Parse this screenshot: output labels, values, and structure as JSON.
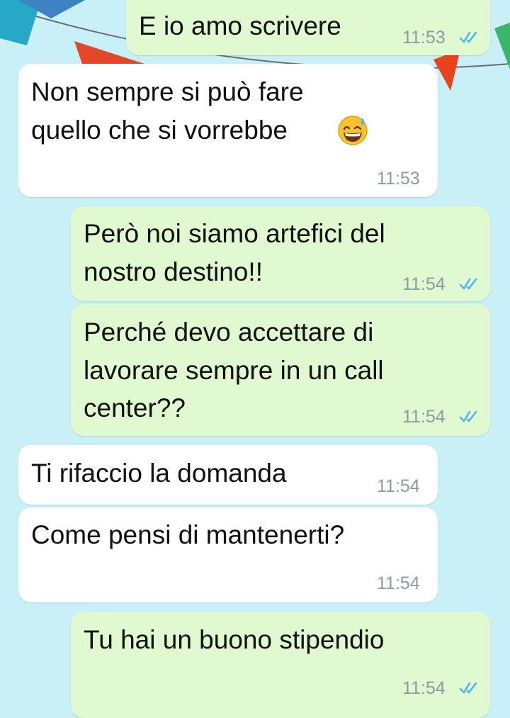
{
  "messages": [
    {
      "id": "m1",
      "direction": "outgoing",
      "lines": [
        "E io amo scrivere"
      ],
      "time": "11:53",
      "status": "read-double-check-icon"
    },
    {
      "id": "m2",
      "direction": "incoming",
      "lines": [
        "Non sempre si può fare",
        "quello che si vorrebbe"
      ],
      "emoji": "grinning-sweat-emoji",
      "time": "11:53"
    },
    {
      "id": "m3",
      "direction": "outgoing",
      "lines": [
        "Però noi siamo artefici del",
        "nostro destino!!"
      ],
      "time": "11:54",
      "status": "read-double-check-icon"
    },
    {
      "id": "m4",
      "direction": "outgoing",
      "lines": [
        "Perché devo accettare di",
        "lavorare sempre in un call",
        "center??"
      ],
      "time": "11:54",
      "status": "read-double-check-icon"
    },
    {
      "id": "m5",
      "direction": "incoming",
      "lines": [
        "Ti rifaccio la domanda"
      ],
      "time": "11:54"
    },
    {
      "id": "m6",
      "direction": "incoming",
      "lines": [
        "Come pensi di mantenerti?"
      ],
      "time": "11:54"
    },
    {
      "id": "m7",
      "direction": "outgoing",
      "lines": [
        "Tu hai un buono stipendio"
      ],
      "time": "11:54",
      "status": "read-double-check-icon"
    }
  ],
  "colors": {
    "background": "#c9f0f7",
    "outgoing_bubble": "#e1f9d0",
    "incoming_bubble": "#ffffff",
    "read_ticks": "#4fb6ec",
    "timestamp": "#8c9aa2"
  }
}
